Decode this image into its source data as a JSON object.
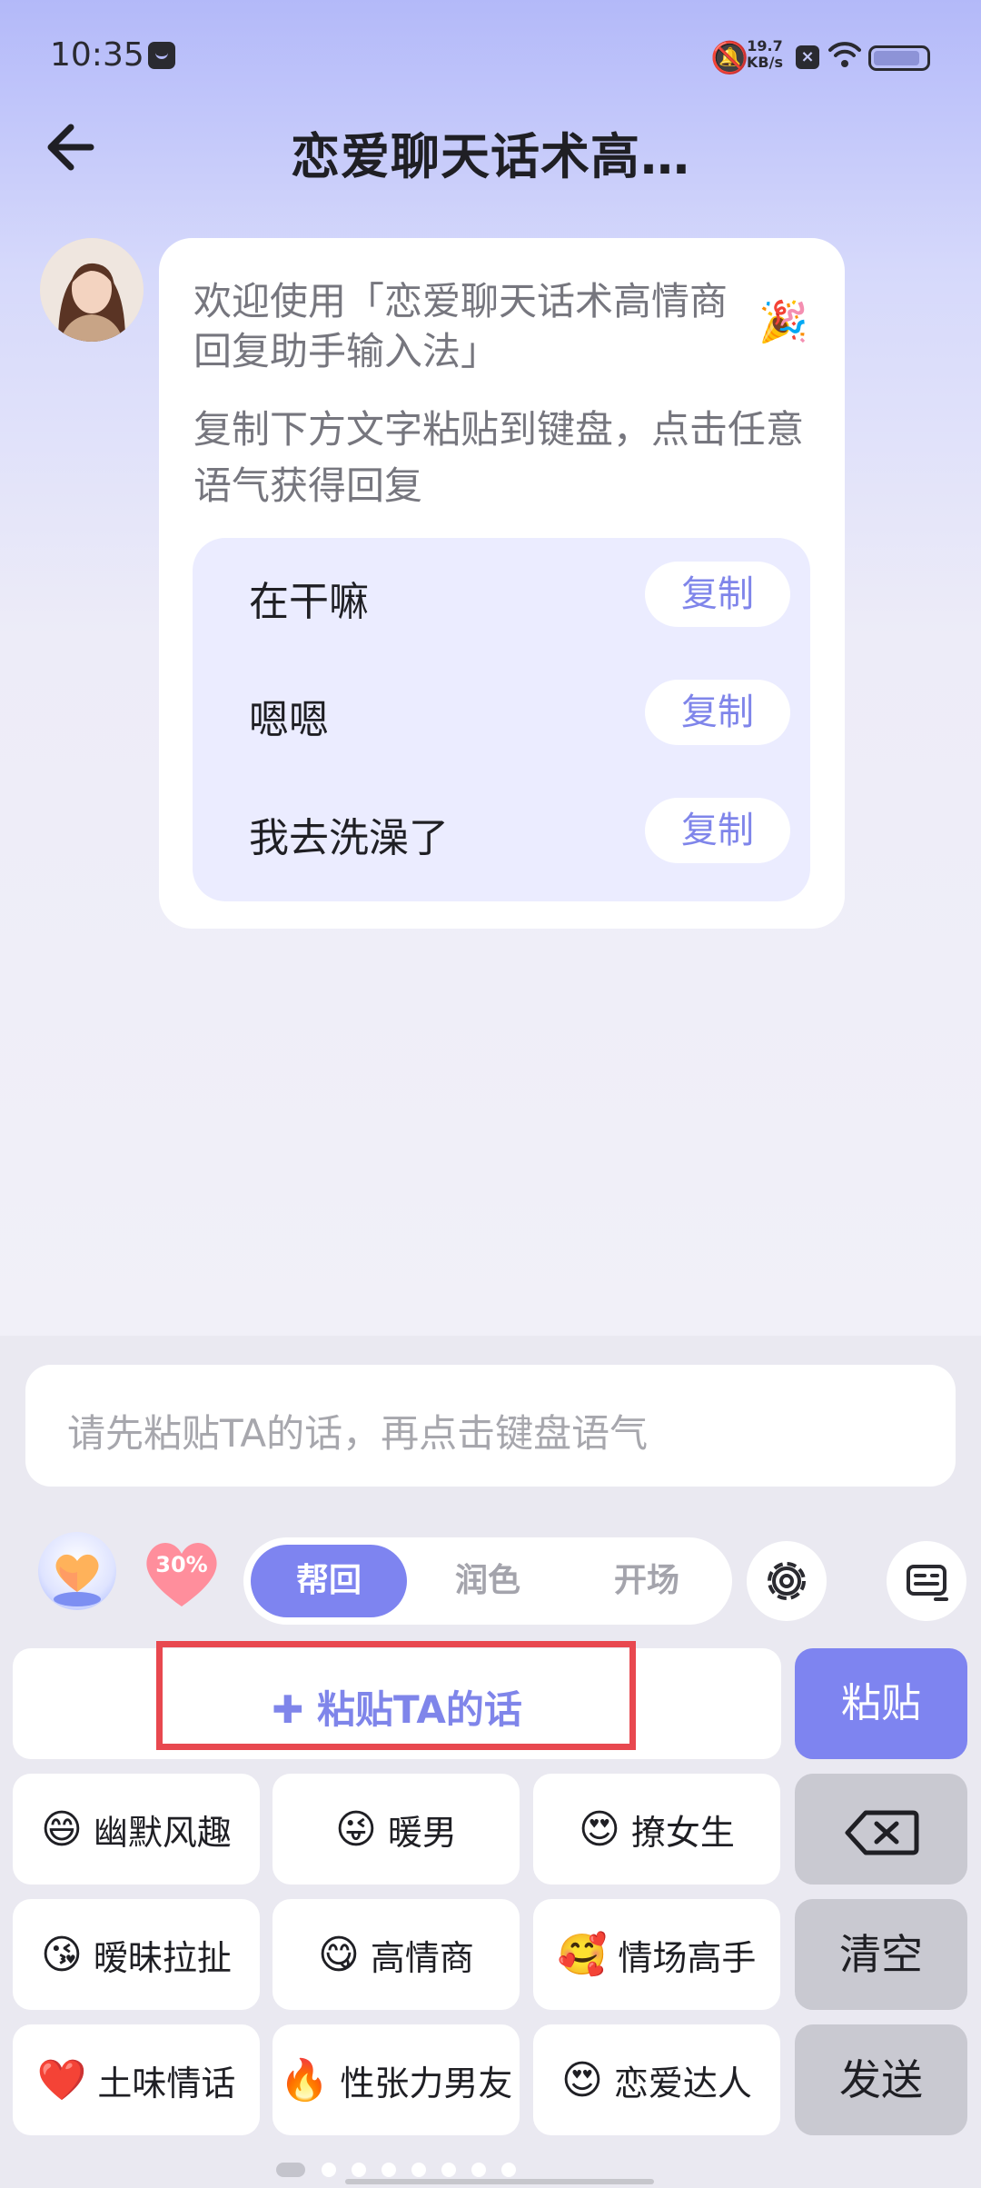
{
  "status_bar": {
    "time": "10:35",
    "net_speed_value": "19.7",
    "net_speed_unit": "KB/s",
    "battery_level": 0.9
  },
  "header": {
    "title": "恋爱聊天话术高…",
    "back_icon": "arrow-left-icon"
  },
  "chat": {
    "welcome": "欢迎使用「恋爱聊天话术高情商回复助手输入法」",
    "party_icon": "🎉",
    "hint": "复制下方文字粘贴到键盘，点击任意语气获得回复",
    "phrases": [
      {
        "text": "在干嘛",
        "copy_label": "复制"
      },
      {
        "text": "嗯嗯",
        "copy_label": "复制"
      },
      {
        "text": "我去洗澡了",
        "copy_label": "复制"
      }
    ]
  },
  "keyboard": {
    "input_placeholder": "请先粘贴TA的话，再点击键盘语气",
    "heart_badge": "30%",
    "modes": [
      "帮回",
      "润色",
      "开场"
    ],
    "active_mode": "帮回",
    "paste_field_label": "粘贴TA的话",
    "paste_button": "粘贴",
    "tones": [
      {
        "emoji": "😄",
        "label": "幽默风趣"
      },
      {
        "emoji": "😜",
        "label": "暖男"
      },
      {
        "emoji": "😍",
        "label": "撩女生"
      },
      {
        "emoji": "😘",
        "label": "暧昧拉扯"
      },
      {
        "emoji": "😋",
        "label": "高情商"
      },
      {
        "emoji": "🥰",
        "label": "情场高手"
      },
      {
        "emoji": "❤️",
        "label": "土味情话"
      },
      {
        "emoji": "🔥",
        "label": "性张力男友"
      },
      {
        "emoji": "😍",
        "label": "恋爱达人"
      }
    ],
    "side_keys": {
      "clear": "清空",
      "send": "发送"
    },
    "page_count": 8,
    "current_page": 1
  },
  "colors": {
    "accent": "#7e84f0",
    "highlight_box": "#e8484f"
  }
}
